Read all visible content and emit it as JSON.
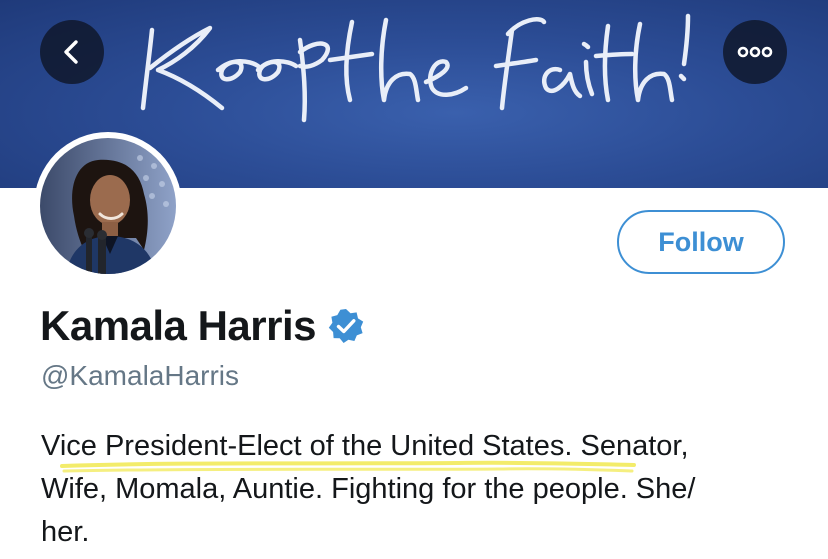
{
  "header": {
    "banner_script_text": "Keep the faith!",
    "back_icon": "chevron-left-icon",
    "more_icon": "ellipsis-icon"
  },
  "profile": {
    "display_name": "Kamala Harris",
    "verified_icon": "verified-badge-icon",
    "handle": "@KamalaHarris",
    "follow_label": "Follow",
    "bio_lines": [
      "Vice President-Elect of the United States. Senator,",
      "Wife, Momala, Auntie. Fighting for the people. She/",
      "her."
    ]
  },
  "colors": {
    "banner": "#2c4d96",
    "accent": "#3d8fd4",
    "verified": "#3d8fd4",
    "handle": "#657786",
    "text": "#14171a",
    "highlight": "#f3ec6a"
  }
}
